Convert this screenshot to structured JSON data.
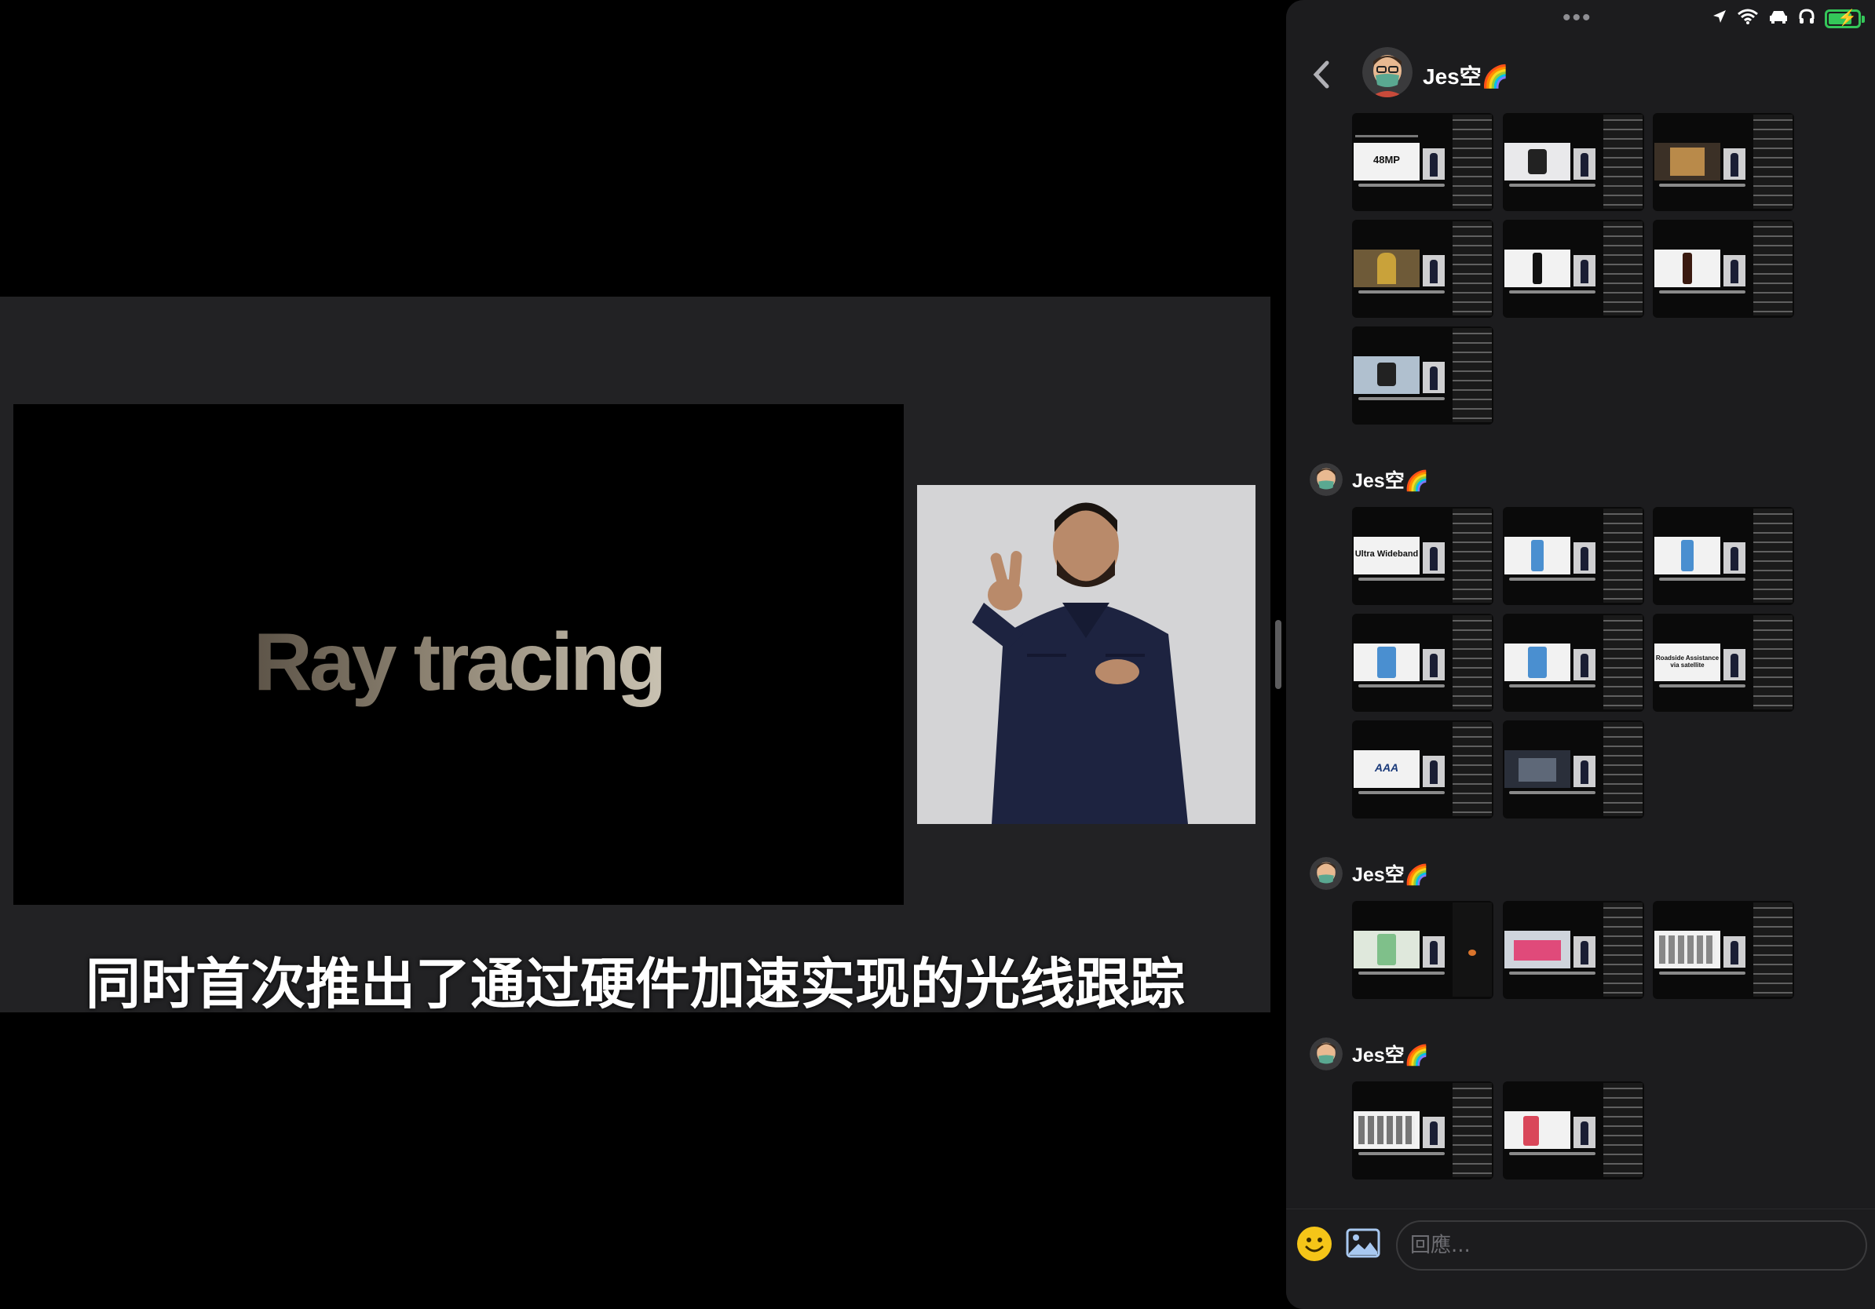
{
  "video": {
    "slide_title": "Ray tracing",
    "caption": "同时首次推出了通过硬件加速实现的光线跟踪"
  },
  "chat": {
    "header": {
      "name": "Jes空🌈",
      "back_icon": "chevron-left-icon"
    },
    "status_bar": {
      "icons": [
        "location-arrow-icon",
        "wifi-icon",
        "car-icon",
        "headphones-icon",
        "battery-charging-icon"
      ],
      "battery_level": 0.8,
      "battery_color": "#34c759"
    },
    "messages": [
      {
        "sender": "Jes空🌈",
        "thumbnails": [
          {
            "mini_title": "48MP"
          },
          {
            "mini_title": ""
          },
          {
            "mini_title": ""
          },
          {
            "mini_title": ""
          },
          {
            "mini_title": ""
          },
          {
            "mini_title": ""
          },
          {
            "mini_title": ""
          }
        ]
      },
      {
        "sender": "Jes空🌈",
        "thumbnails": [
          {
            "mini_title": "Ultra Wideband"
          },
          {
            "mini_title": ""
          },
          {
            "mini_title": ""
          },
          {
            "mini_title": ""
          },
          {
            "mini_title": ""
          },
          {
            "mini_title": "Roadside Assistance via satellite"
          },
          {
            "mini_title": "AAA"
          },
          {
            "mini_title": ""
          }
        ]
      },
      {
        "sender": "Jes空🌈",
        "thumbnails": [
          {
            "mini_title": ""
          },
          {
            "mini_title": ""
          },
          {
            "mini_title": ""
          }
        ]
      },
      {
        "sender": "Jes空🌈",
        "thumbnails": [
          {
            "mini_title": ""
          },
          {
            "mini_title": ""
          }
        ]
      }
    ],
    "composer": {
      "placeholder": "回應...",
      "emoji_icon": "smiley-icon",
      "photo_icon": "photo-icon"
    }
  }
}
